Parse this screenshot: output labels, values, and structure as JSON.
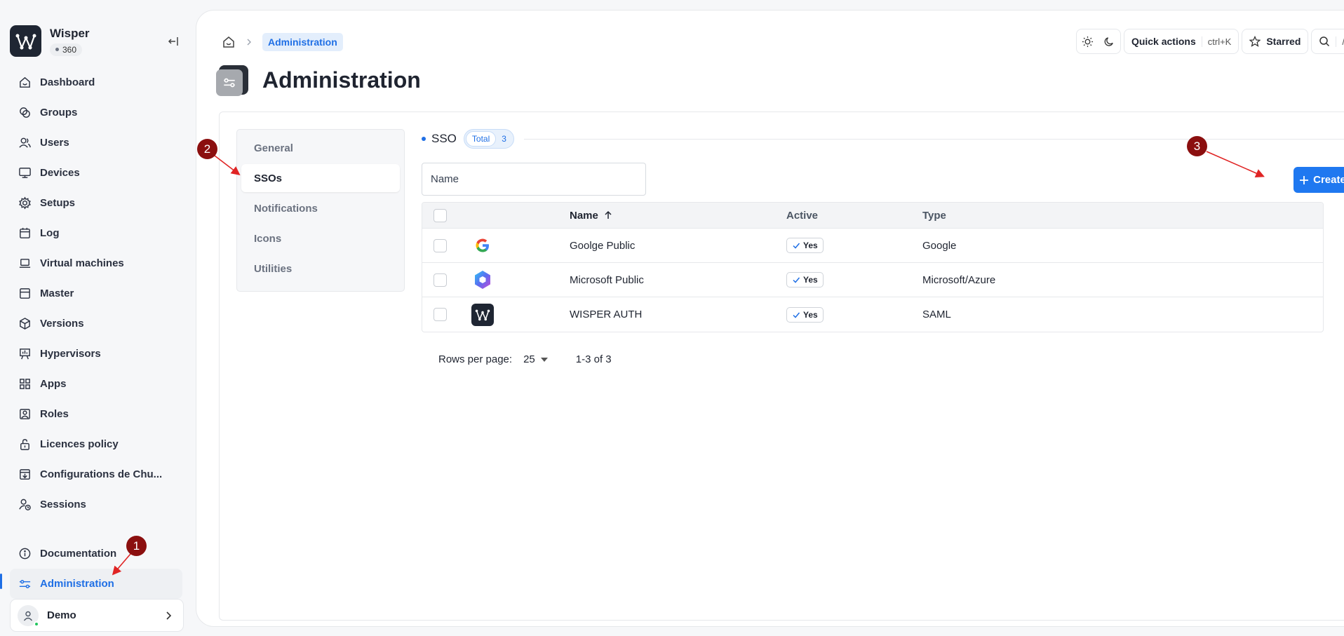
{
  "app": {
    "name": "Wisper",
    "badge": "360"
  },
  "nav": {
    "items": [
      {
        "label": "Dashboard",
        "icon": "home-icon"
      },
      {
        "label": "Groups",
        "icon": "groups-icon"
      },
      {
        "label": "Users",
        "icon": "users-icon"
      },
      {
        "label": "Devices",
        "icon": "monitor-icon"
      },
      {
        "label": "Setups",
        "icon": "gear-icon"
      },
      {
        "label": "Log",
        "icon": "calendar-icon"
      },
      {
        "label": "Virtual machines",
        "icon": "laptop-icon"
      },
      {
        "label": "Master",
        "icon": "window-icon"
      },
      {
        "label": "Versions",
        "icon": "package-icon"
      },
      {
        "label": "Hypervisors",
        "icon": "presentation-icon"
      },
      {
        "label": "Apps",
        "icon": "grid-icon"
      },
      {
        "label": "Roles",
        "icon": "id-card-icon"
      },
      {
        "label": "Licences policy",
        "icon": "unlock-icon"
      },
      {
        "label": "Configurations de Chu...",
        "icon": "download-box-icon"
      },
      {
        "label": "Sessions",
        "icon": "user-clock-icon"
      }
    ],
    "bottom": [
      {
        "label": "Documentation",
        "icon": "info-icon"
      },
      {
        "label": "Administration",
        "icon": "sliders-icon"
      }
    ]
  },
  "user": {
    "name": "Demo"
  },
  "breadcrumb": {
    "current": "Administration"
  },
  "topbar": {
    "quick_actions": "Quick actions",
    "shortcut": "ctrl+K",
    "starred": "Starred",
    "search_shortcut": "/"
  },
  "page": {
    "title": "Administration"
  },
  "tabs": [
    "General",
    "SSOs",
    "Notifications",
    "Icons",
    "Utilities"
  ],
  "section": {
    "title": "SSO",
    "total_label": "Total",
    "total_count": "3"
  },
  "filter": {
    "placeholder": "Name"
  },
  "create_label": "Create",
  "table": {
    "headers": {
      "name": "Name",
      "active": "Active",
      "type": "Type"
    },
    "rows": [
      {
        "name": "Goolge Public",
        "active": "Yes",
        "type": "Google",
        "icon": "google-icon"
      },
      {
        "name": "Microsoft Public",
        "active": "Yes",
        "type": "Microsoft/Azure",
        "icon": "microsoft-icon"
      },
      {
        "name": "WISPER AUTH",
        "active": "Yes",
        "type": "SAML",
        "icon": "wisper-icon"
      }
    ]
  },
  "pagination": {
    "rows_per_page_label": "Rows per page:",
    "rows_per_page": "25",
    "range": "1-3 of 3"
  },
  "annotations": [
    "1",
    "2",
    "3"
  ],
  "colors": {
    "accent": "#1f6fe5",
    "create": "#1f78f0",
    "annotation": "#8b0f0f"
  }
}
